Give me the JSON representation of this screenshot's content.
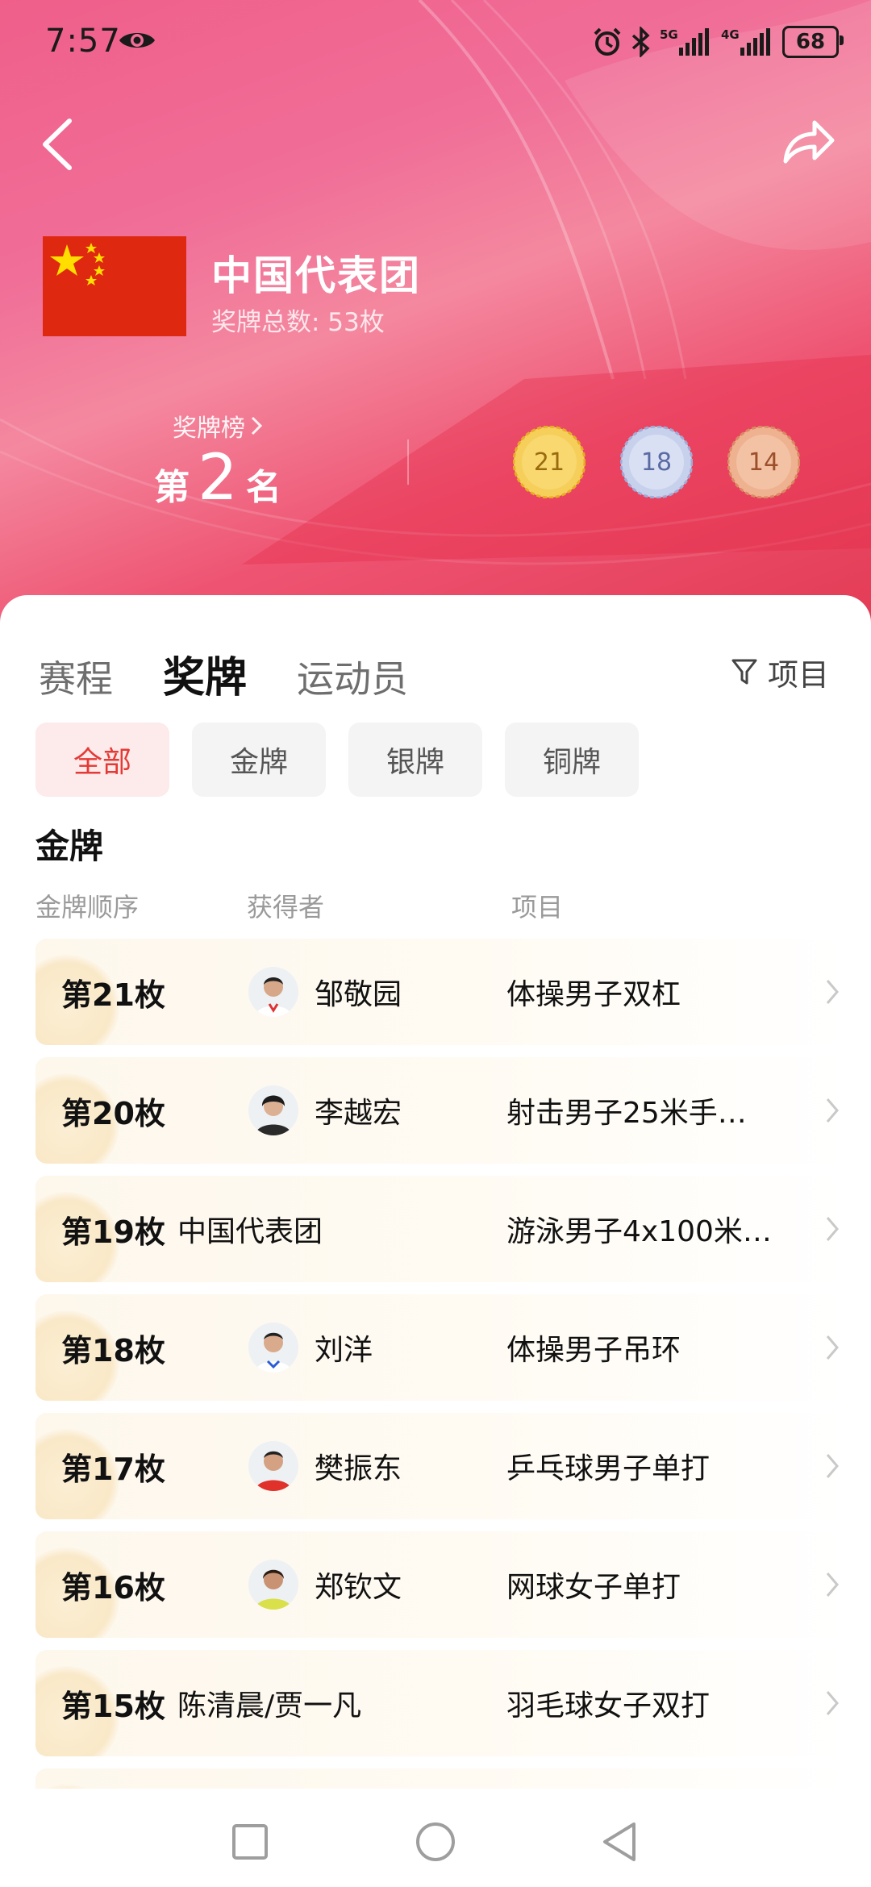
{
  "status": {
    "time": "7:57",
    "battery": "68",
    "net1": "5G",
    "net2": "4G"
  },
  "header": {
    "team_name": "中国代表团",
    "total_label": "奖牌总数: 53枚",
    "rank_link": "奖牌榜",
    "rank_prefix": "第",
    "rank_value": "2",
    "rank_suffix": "名",
    "medals": [
      {
        "type": "gold",
        "count": "21",
        "color": "#f2c646"
      },
      {
        "type": "silver",
        "count": "18",
        "color": "#c8d3ec"
      },
      {
        "type": "bronze",
        "count": "14",
        "color": "#efb08e"
      }
    ]
  },
  "tabs": [
    {
      "label": "赛程",
      "active": false
    },
    {
      "label": "奖牌",
      "active": true
    },
    {
      "label": "运动员",
      "active": false
    }
  ],
  "filter_label": "项目",
  "chips": [
    {
      "label": "全部",
      "active": true
    },
    {
      "label": "金牌",
      "active": false
    },
    {
      "label": "银牌",
      "active": false
    },
    {
      "label": "铜牌",
      "active": false
    }
  ],
  "section_title": "金牌",
  "columns": {
    "order": "金牌顺序",
    "winner": "获得者",
    "event": "项目"
  },
  "rows": [
    {
      "order": "第21枚",
      "winner": "邹敬园",
      "event": "体操男子双杠",
      "avatar": true
    },
    {
      "order": "第20枚",
      "winner": "李越宏",
      "event": "射击男子25米手…",
      "avatar": true
    },
    {
      "order": "第19枚",
      "winner": "中国代表团",
      "event": "游泳男子4x100米…",
      "avatar": false
    },
    {
      "order": "第18枚",
      "winner": "刘洋",
      "event": "体操男子吊环",
      "avatar": true
    },
    {
      "order": "第17枚",
      "winner": "樊振东",
      "event": "乒乓球男子单打",
      "avatar": true
    },
    {
      "order": "第16枚",
      "winner": "郑钦文",
      "event": "网球女子单打",
      "avatar": true
    },
    {
      "order": "第15枚",
      "winner": "陈清晨/贾一凡",
      "event": "羽毛球女子双打",
      "avatar": false
    }
  ],
  "colors": {
    "accent": "#e53935",
    "hero_pink": "#ef5f8a",
    "hero_red": "#e33b55"
  }
}
